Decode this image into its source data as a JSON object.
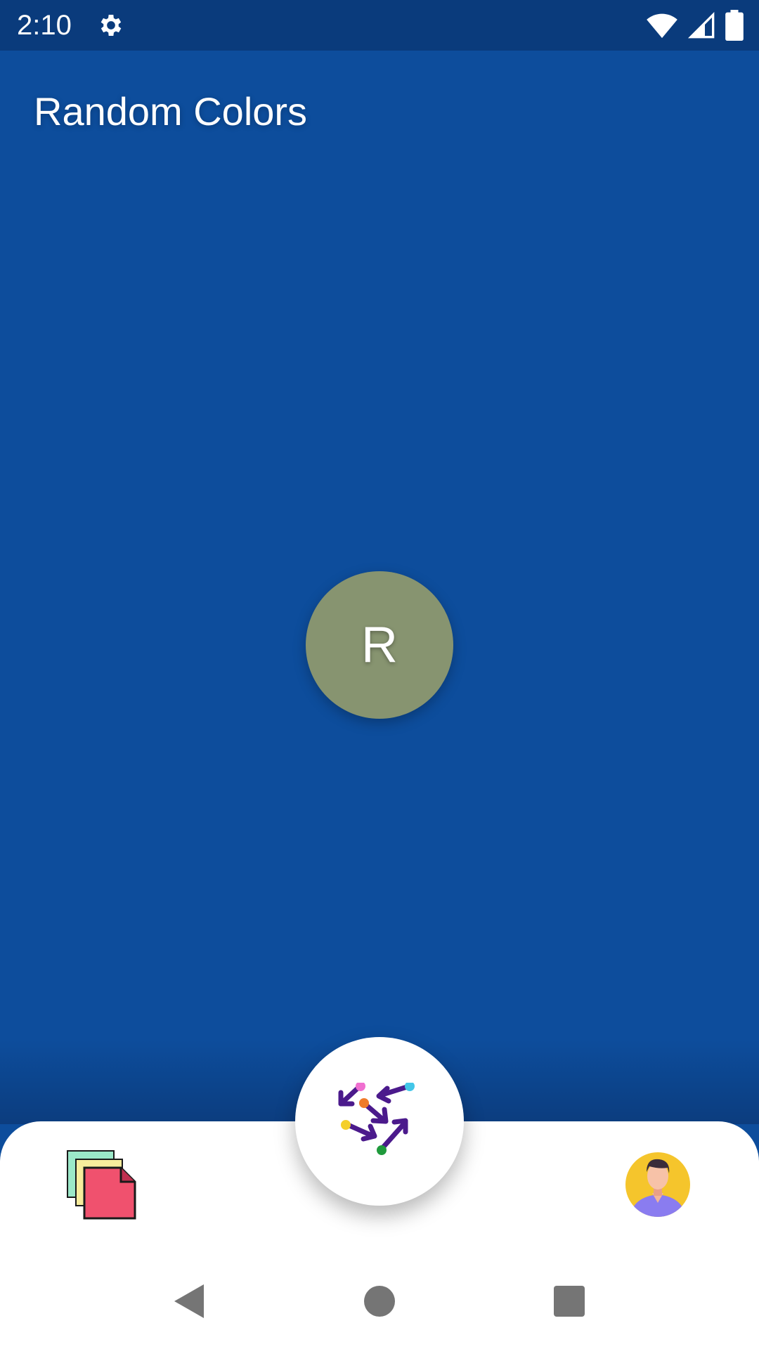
{
  "status_bar": {
    "time": "2:10",
    "icons": [
      "settings-gear-icon",
      "wifi-icon",
      "cell-signal-icon",
      "battery-icon"
    ]
  },
  "app": {
    "title": "Random Colors",
    "background_color": "#0d4d9c"
  },
  "avatar": {
    "letter": "R",
    "color": "#879470"
  },
  "bottom_nav": {
    "left_icon": "stacked-colors-icon",
    "center_icon": "random-arrows-icon",
    "right_icon": "user-profile-icon"
  },
  "system_nav": {
    "buttons": [
      "back-icon",
      "home-icon",
      "recents-icon"
    ]
  }
}
